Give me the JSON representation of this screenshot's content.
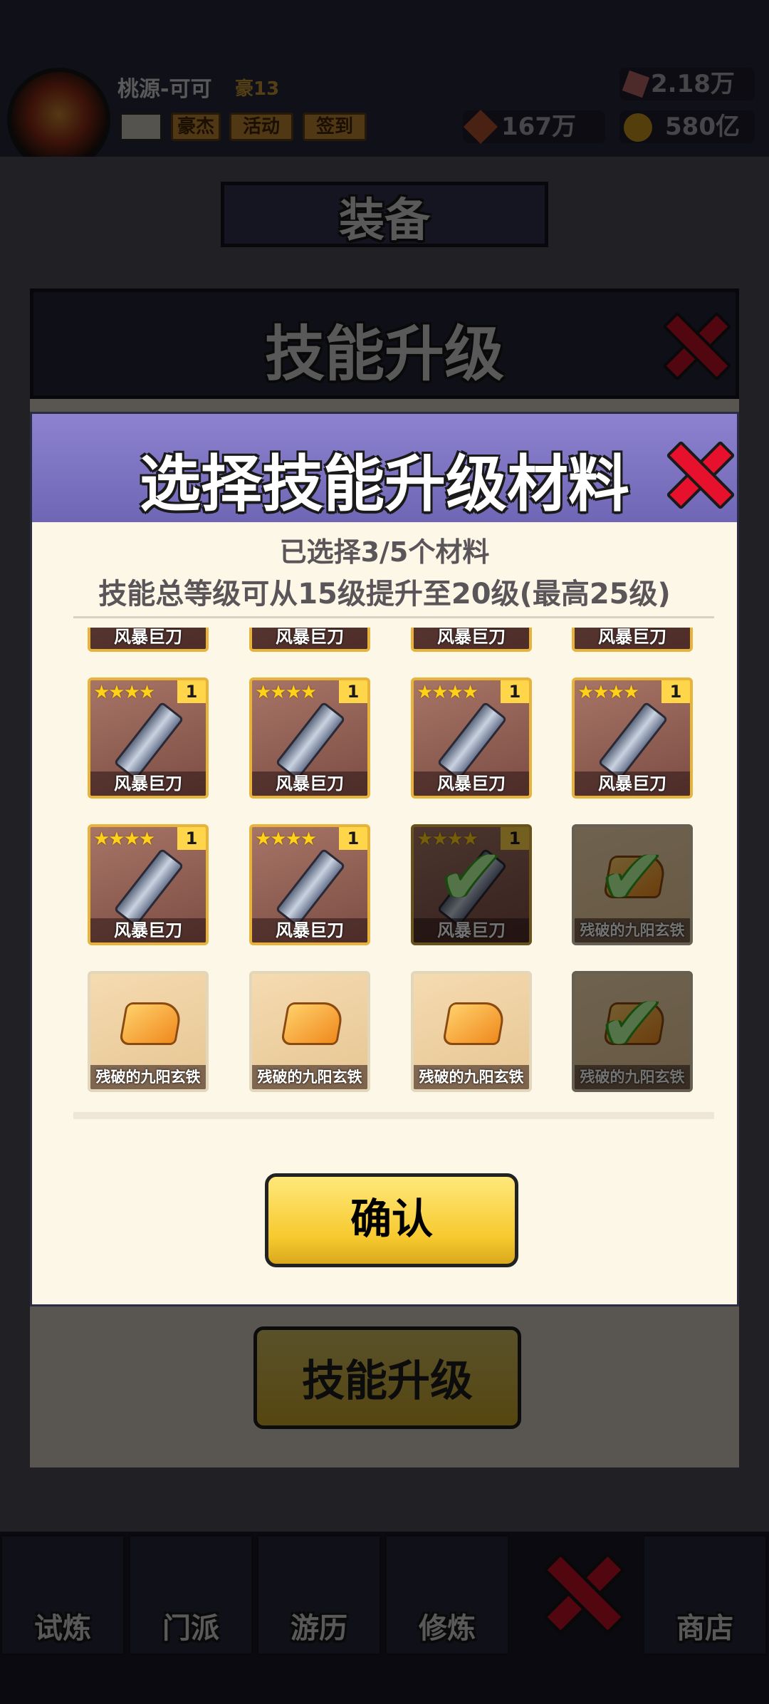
{
  "header": {
    "player_name": "桃源-可可",
    "badge": "豪13",
    "chips": [
      "豪杰",
      "活动",
      "签到"
    ],
    "resources": {
      "gems": "2.18万",
      "tokens": "167万",
      "gold": "580亿"
    }
  },
  "background": {
    "equip_tab_title": "装备",
    "skill_upgrade_title": "技能升级",
    "bottom_button": "技能升级",
    "nav": [
      "试炼",
      "门派",
      "游历",
      "修炼",
      "",
      "商店"
    ]
  },
  "dialog": {
    "title": "选择技能升级材料",
    "selected_info": "已选择3/5个材料",
    "level_info": "技能总等级可从15级提升至20级(最高25级)",
    "confirm_label": "确认",
    "materials": [
      {
        "name": "风暴巨刀",
        "type": "blade",
        "stars": "★★★★",
        "level": "1",
        "selected": false
      },
      {
        "name": "风暴巨刀",
        "type": "blade",
        "stars": "★★★★",
        "level": "1",
        "selected": false
      },
      {
        "name": "风暴巨刀",
        "type": "blade",
        "stars": "★★★★",
        "level": "1",
        "selected": false
      },
      {
        "name": "风暴巨刀",
        "type": "blade",
        "stars": "★★★★",
        "level": "1",
        "selected": false
      },
      {
        "name": "风暴巨刀",
        "type": "blade",
        "stars": "★★★★",
        "level": "1",
        "selected": false
      },
      {
        "name": "风暴巨刀",
        "type": "blade",
        "stars": "★★★★",
        "level": "1",
        "selected": false
      },
      {
        "name": "风暴巨刀",
        "type": "blade",
        "stars": "★★★★",
        "level": "1",
        "selected": true
      },
      {
        "name": "残破的九阳玄铁",
        "type": "ore",
        "selected": true
      },
      {
        "name": "残破的九阳玄铁",
        "type": "ore",
        "selected": false
      },
      {
        "name": "残破的九阳玄铁",
        "type": "ore",
        "selected": false
      },
      {
        "name": "残破的九阳玄铁",
        "type": "ore",
        "selected": false
      },
      {
        "name": "残破的九阳玄铁",
        "type": "ore",
        "selected": true
      }
    ],
    "partial_row_label": "风暴巨刀"
  }
}
